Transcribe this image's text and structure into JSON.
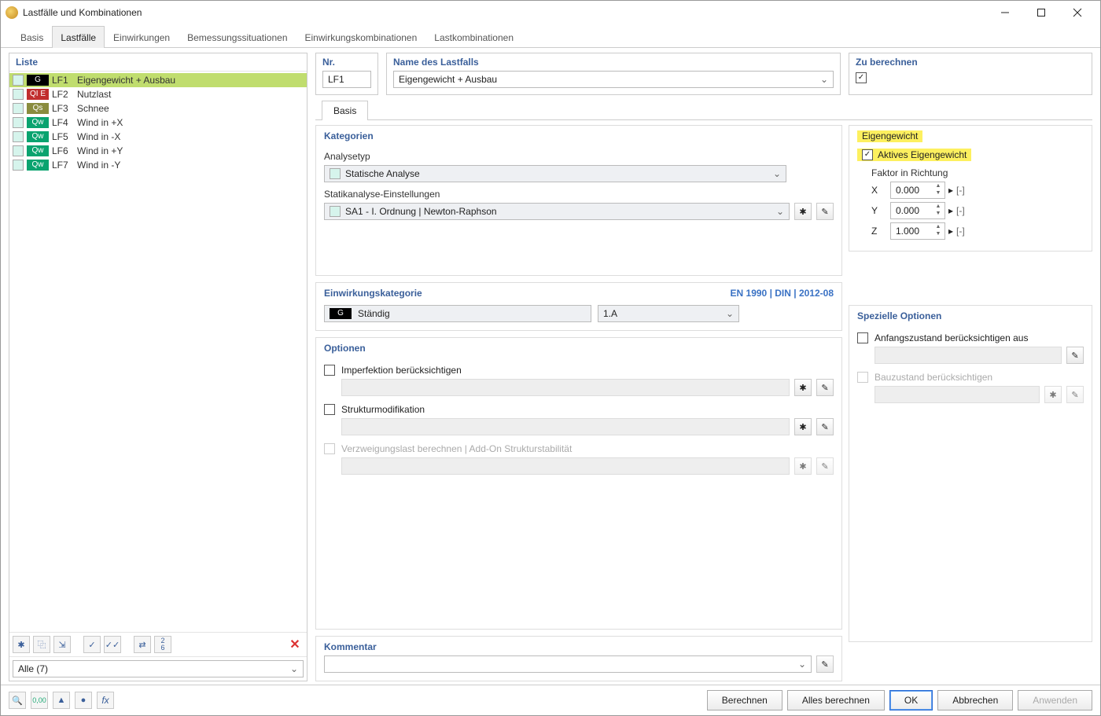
{
  "window": {
    "title": "Lastfälle und Kombinationen"
  },
  "main_tabs": [
    "Basis",
    "Lastfälle",
    "Einwirkungen",
    "Bemessungssituationen",
    "Einwirkungskombinationen",
    "Lastkombinationen"
  ],
  "main_tab_active": 1,
  "left": {
    "header": "Liste",
    "filter": "Alle (7)",
    "rows": [
      {
        "tag": "G",
        "tagClass": "G",
        "lf": "LF1",
        "name": "Eigengewicht + Ausbau",
        "selected": true
      },
      {
        "tag": "QI E",
        "tagClass": "QIE",
        "lf": "LF2",
        "name": "Nutzlast"
      },
      {
        "tag": "Qs",
        "tagClass": "Qs",
        "lf": "LF3",
        "name": "Schnee"
      },
      {
        "tag": "Qw",
        "tagClass": "Qw",
        "lf": "LF4",
        "name": "Wind in +X"
      },
      {
        "tag": "Qw",
        "tagClass": "Qw",
        "lf": "LF5",
        "name": "Wind in -X"
      },
      {
        "tag": "Qw",
        "tagClass": "Qw",
        "lf": "LF6",
        "name": "Wind in +Y"
      },
      {
        "tag": "Qw",
        "tagClass": "Qw",
        "lf": "LF7",
        "name": "Wind in -Y"
      }
    ]
  },
  "header_fields": {
    "nr_label": "Nr.",
    "nr_value": "LF1",
    "name_label": "Name des Lastfalls",
    "name_value": "Eigengewicht + Ausbau",
    "calc_label": "Zu berechnen",
    "calc_checked": true
  },
  "sub_tab": "Basis",
  "kategorien": {
    "header": "Kategorien",
    "analysetyp_label": "Analysetyp",
    "analysetyp_value": "Statische Analyse",
    "statik_label": "Statikanalyse-Einstellungen",
    "statik_value": "SA1 - I. Ordnung | Newton-Raphson"
  },
  "einwirkung": {
    "header": "Einwirkungskategorie",
    "standard": "EN 1990 | DIN | 2012-08",
    "cat_tag": "G",
    "cat_label": "Ständig",
    "cat_code": "1.A"
  },
  "optionen": {
    "header": "Optionen",
    "imperfektion": "Imperfektion berücksichtigen",
    "struktur": "Strukturmodifikation",
    "verzweig": "Verzweigungslast berechnen | Add-On Strukturstabilität"
  },
  "eigengewicht": {
    "header": "Eigengewicht",
    "aktiv_label": "Aktives Eigengewicht",
    "aktiv_checked": true,
    "faktor_label": "Faktor in Richtung",
    "x_label": "X",
    "x_value": "0.000",
    "y_label": "Y",
    "y_value": "0.000",
    "z_label": "Z",
    "z_value": "1.000",
    "unit": "[-]"
  },
  "spezielle": {
    "header": "Spezielle Optionen",
    "anfang": "Anfangszustand berücksichtigen aus",
    "bau": "Bauzustand berücksichtigen"
  },
  "kommentar": {
    "header": "Kommentar"
  },
  "buttons": {
    "berechnen": "Berechnen",
    "alles": "Alles berechnen",
    "ok": "OK",
    "abbrechen": "Abbrechen",
    "anwenden": "Anwenden"
  }
}
